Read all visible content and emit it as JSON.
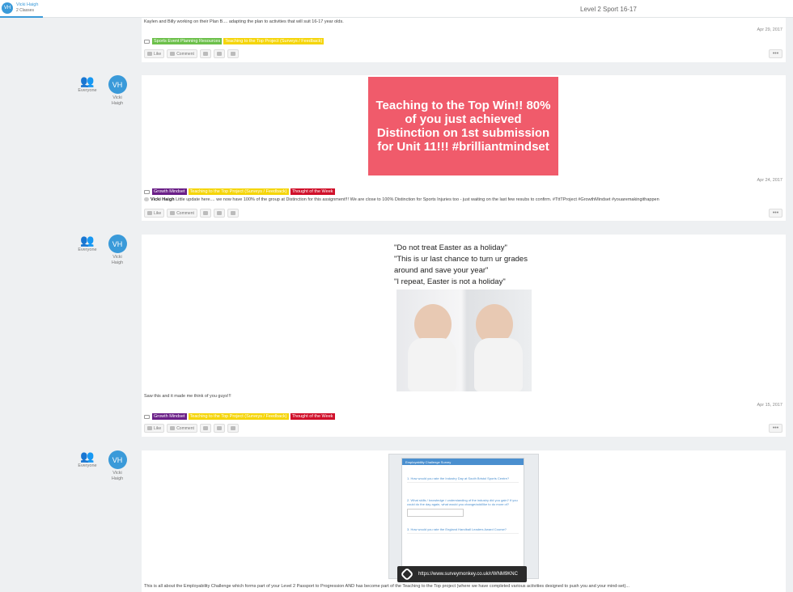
{
  "header": {
    "user_initials": "VH",
    "user_name": "Vicki Haigh",
    "user_sub": "2 Classes",
    "class_name": "Level 2 Sport 16-17"
  },
  "common": {
    "everyone": "Everyone",
    "author_initials": "VH",
    "author_line1": "Vicki",
    "author_line2": "Haigh",
    "like": "Like",
    "comment": "Comment",
    "more": "•••"
  },
  "post0": {
    "text": "Kaylen and Billy working on their Plan B.... adapting the plan to activities that will suit 16-17 year olds.",
    "date": "Apr 29, 2017",
    "tags": [
      "Sports Event Planning Resources",
      "Teaching to the Top Project (Surveys / Feedback)"
    ]
  },
  "post1": {
    "card": "Teaching to the Top Win!! 80% of you just achieved Distinction on 1st submission for Unit 11!!! #brilliantmindset",
    "date": "Apr 24, 2017",
    "tags": [
      "Growth Mindset",
      "Teaching to the Top Project (Surveys / Feedback)",
      "Thought of the Week"
    ],
    "comment_author": "Vicki Haigh",
    "comment_text": "Little update here.... we now have 100% of the group at Distinction for this assignment!!! We are close to 100% Distinction for Sports Injuries too - just waiting on the last few resubs to confirm. #TttTProject #GrowthMindset #youaremakingithappen"
  },
  "post2": {
    "quote": [
      "\"Do not treat Easter as a holiday\"",
      "\"This is ur last chance to turn ur grades",
      "around and save your year\"",
      "\"I repeat, Easter is not a holiday\""
    ],
    "text": "Saw this and it made me think of you guys!!!",
    "date": "Apr 15, 2017",
    "tags": [
      "Growth Mindset",
      "Teaching to the Top Project (Surveys / Feedback)",
      "Thought of the Week"
    ]
  },
  "post3": {
    "survey_title": "Employability Challenge Survey",
    "q1": "1. How would you rate the Industry Day at South Bristol Sports Centre?",
    "q2": "2. What skills / knowledge / understanding of the industry did you gain? If you could do the day again, what would you change/add/like to do more of?",
    "q3": "3. How would you rate the England Handball Leaders Award Course?",
    "link": "https://www.surveymonkey.co.uk/r/WNM9KNC",
    "text": "This is all about the Employability Challenge which forms part of your Level 2 Passport to Progression AND has become part of the Teaching to the Top project (where we have completed various activities designed to push you and your mind-set)..."
  },
  "colors": {
    "accent": "#3a9ad9",
    "card": "#f05b6b",
    "tag_green": "#6cc04a",
    "tag_yellow": "#f5d50a",
    "tag_purple": "#6a1f87",
    "tag_red": "#d0102a"
  }
}
